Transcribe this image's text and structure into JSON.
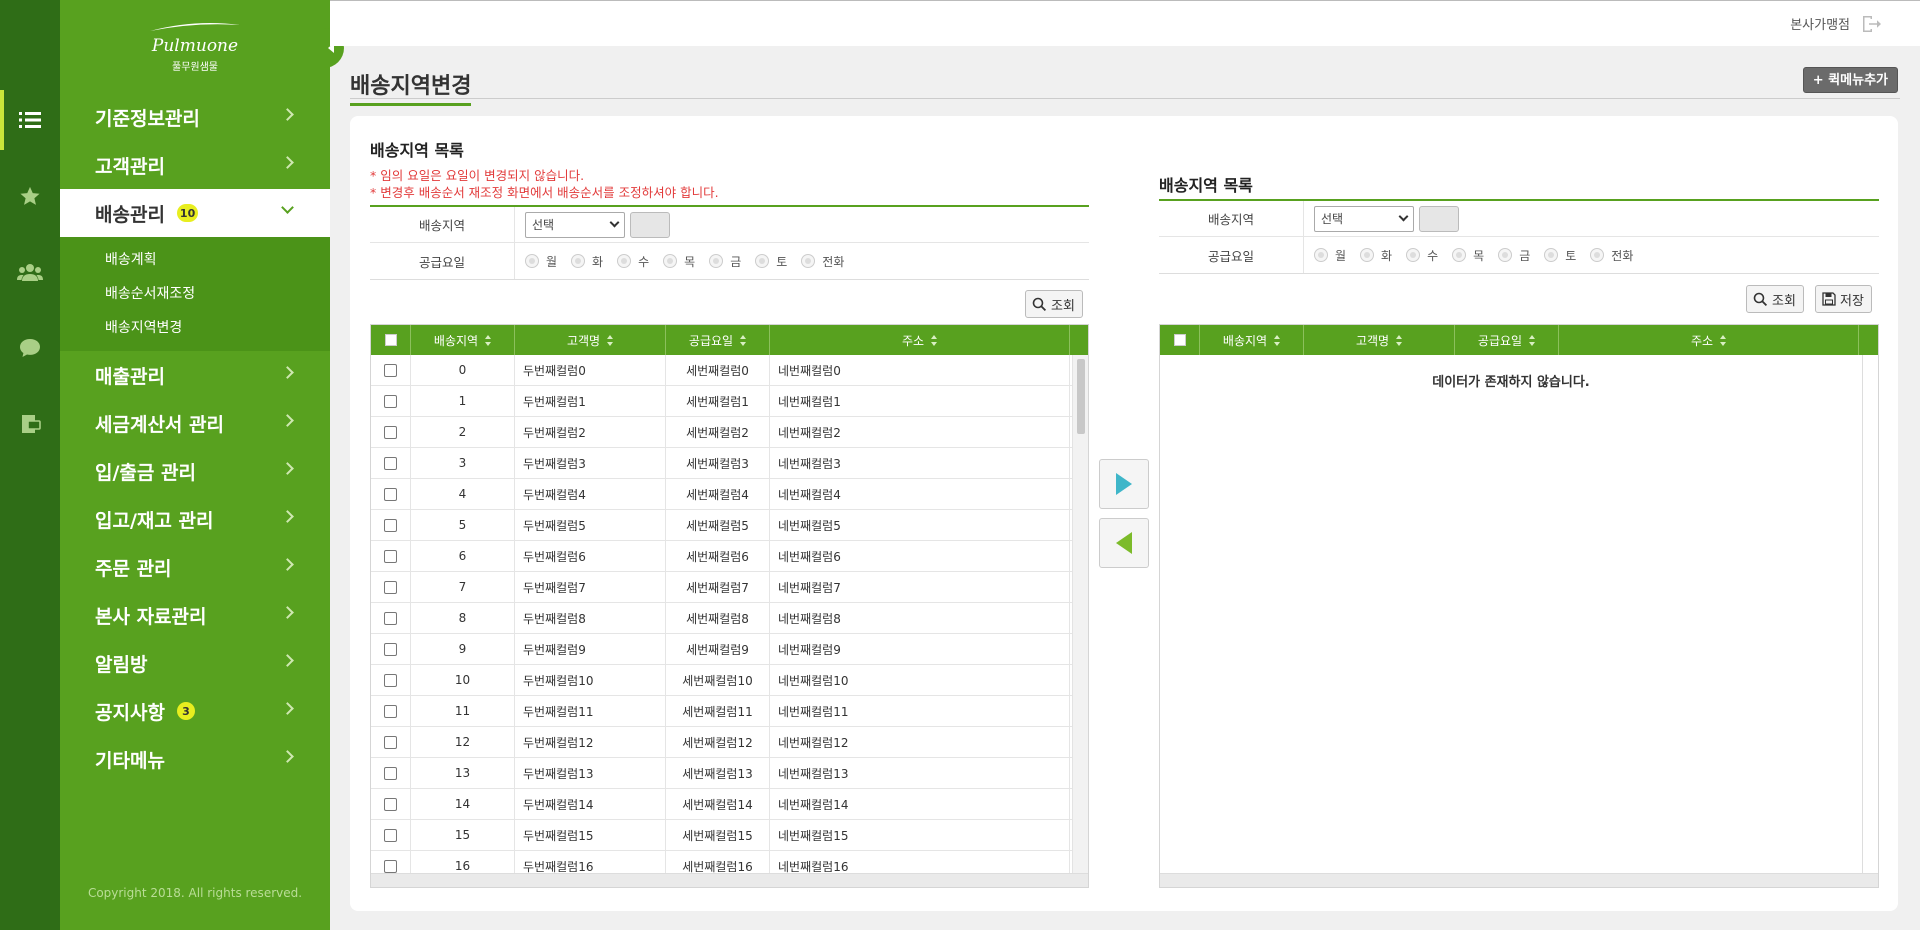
{
  "rail": {
    "icons": [
      "list-icon",
      "star-icon",
      "users-icon",
      "chat-icon",
      "coupon-icon"
    ]
  },
  "brand": {
    "logo": "Pulmuone",
    "sub": "풀무원샘물"
  },
  "menu": {
    "items": [
      {
        "label": "기준정보관리"
      },
      {
        "label": "고객관리"
      },
      {
        "label": "배송관리",
        "badge": "10"
      },
      {
        "label": "매출관리"
      },
      {
        "label": "세금계산서 관리"
      },
      {
        "label": "입/출금 관리"
      },
      {
        "label": "입고/재고 관리"
      },
      {
        "label": "주문 관리"
      },
      {
        "label": "본사 자료관리"
      },
      {
        "label": "알림방"
      },
      {
        "label": "공지사항",
        "badge": "3"
      },
      {
        "label": "기타메뉴"
      }
    ],
    "submenu": [
      "배송계획",
      "배송순서재조정",
      "배송지역변경"
    ],
    "copyright": "Copyright 2018. All rights reserved."
  },
  "header": {
    "store_name": "본사가맹점"
  },
  "page": {
    "title": "배송지역변경",
    "quick_menu": "+ 퀵메뉴추가"
  },
  "left": {
    "title": "배송지역 목록",
    "notice1": "* 임의 요일은 요일이 변경되지 않습니다.",
    "notice2": "* 변경후 배송순서 재조정 화면에서 배송순서를 조정하셔야 합니다.",
    "filter": {
      "region_label": "배송지역",
      "region_value": "선택",
      "day_label": "공급요일",
      "days": [
        "월",
        "화",
        "수",
        "목",
        "금",
        "토",
        "전화"
      ]
    },
    "search_btn": "조회",
    "columns": [
      "배송지역",
      "고객명",
      "공급요일",
      "주소"
    ],
    "rows": [
      [
        "0",
        "두번째컬럼0",
        "세번째컬럼0",
        "네번째컬럼0"
      ],
      [
        "1",
        "두번째컬럼1",
        "세번째컬럼1",
        "네번째컬럼1"
      ],
      [
        "2",
        "두번째컬럼2",
        "세번째컬럼2",
        "네번째컬럼2"
      ],
      [
        "3",
        "두번째컬럼3",
        "세번째컬럼3",
        "네번째컬럼3"
      ],
      [
        "4",
        "두번째컬럼4",
        "세번째컬럼4",
        "네번째컬럼4"
      ],
      [
        "5",
        "두번째컬럼5",
        "세번째컬럼5",
        "네번째컬럼5"
      ],
      [
        "6",
        "두번째컬럼6",
        "세번째컬럼6",
        "네번째컬럼6"
      ],
      [
        "7",
        "두번째컬럼7",
        "세번째컬럼7",
        "네번째컬럼7"
      ],
      [
        "8",
        "두번째컬럼8",
        "세번째컬럼8",
        "네번째컬럼8"
      ],
      [
        "9",
        "두번째컬럼9",
        "세번째컬럼9",
        "네번째컬럼9"
      ],
      [
        "10",
        "두번째컬럼10",
        "세번째컬럼10",
        "네번째컬럼10"
      ],
      [
        "11",
        "두번째컬럼11",
        "세번째컬럼11",
        "네번째컬럼11"
      ],
      [
        "12",
        "두번째컬럼12",
        "세번째컬럼12",
        "네번째컬럼12"
      ],
      [
        "13",
        "두번째컬럼13",
        "세번째컬럼13",
        "네번째컬럼13"
      ],
      [
        "14",
        "두번째컬럼14",
        "세번째컬럼14",
        "네번째컬럼14"
      ],
      [
        "15",
        "두번째컬럼15",
        "세번째컬럼15",
        "네번째컬럼15"
      ],
      [
        "16",
        "두번째컬럼16",
        "세번째컬럼16",
        "네번째컬럼16"
      ]
    ]
  },
  "right": {
    "title": "배송지역 목록",
    "filter": {
      "region_label": "배송지역",
      "region_value": "선택",
      "day_label": "공급요일",
      "days": [
        "월",
        "화",
        "수",
        "목",
        "금",
        "토",
        "전화"
      ]
    },
    "search_btn": "조회",
    "save_btn": "저장",
    "columns": [
      "배송지역",
      "고객명",
      "공급요일",
      "주소"
    ],
    "empty": "데이터가 존재하지 않습니다."
  },
  "colors": {
    "primary": "#58a11f",
    "rail": "#2f6d17",
    "submenu": "#4b9318",
    "badge": "#e8ee1f",
    "notice": "#e23b3b"
  }
}
